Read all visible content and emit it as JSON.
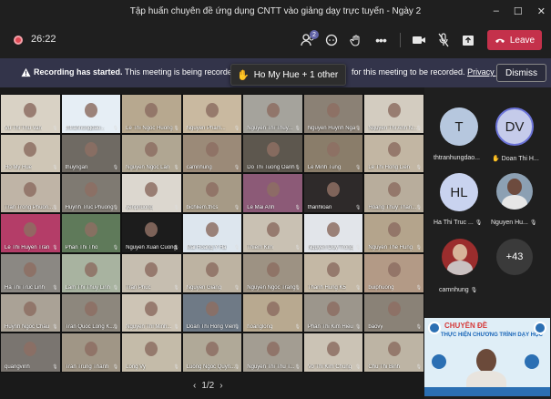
{
  "window": {
    "title": "Tập huấn chuyên đề ứng dụng CNTT vào giảng dạy trực tuyến - Ngày 2",
    "controls": [
      "–",
      "☐",
      "✕"
    ]
  },
  "toolbar": {
    "timer": "26:22",
    "participants_badge": "2",
    "leave_label": "Leave"
  },
  "banner": {
    "bold_text": "Recording has started.",
    "text_before": "This meeting is being recorded. By jo",
    "text_after": "for this meeting to be recorded.",
    "link": "Privacy policy",
    "dismiss_label": "Dismiss"
  },
  "tooltip": {
    "text": "Ho My Hue + 1 other"
  },
  "grid": {
    "tiles": [
      {
        "name": "Vu Thi Thu Van",
        "bg": "#d9d2c5"
      },
      {
        "name": "thtranhungdao...",
        "bg": "#e6eef5"
      },
      {
        "name": "Le Thi Ngoc Huong",
        "bg": "#b7a88f"
      },
      {
        "name": "Nguyen Pham...",
        "bg": "#c9b9a0"
      },
      {
        "name": "Nguyen Thi Thuy...",
        "bg": "#a5a39c"
      },
      {
        "name": "Nguyen Huynh Nga",
        "bg": "#8b8175"
      },
      {
        "name": "Nguyen Thi Anh N...",
        "bg": "#d3ccc0"
      },
      {
        "name": "Ho My Hue",
        "bg": "#cfc6b6"
      },
      {
        "name": "thuyngan",
        "bg": "#6f6a63"
      },
      {
        "name": "Nguyen Ngoc Lan",
        "bg": "#b0a692"
      },
      {
        "name": "camnhung",
        "bg": "#9b8a78"
      },
      {
        "name": "Do Thi Tuong Oanh",
        "bg": "#5d574e"
      },
      {
        "name": "Le Minh Tung",
        "bg": "#8a7d6a"
      },
      {
        "name": "Le Thi Hong Lien",
        "bg": "#c2b6a3"
      },
      {
        "name": "Tran Trong Phuon...",
        "bg": "#bfb4a6"
      },
      {
        "name": "Huynh Truc Phuong",
        "bg": "#7f7a72"
      },
      {
        "name": "yenphuong",
        "bg": "#dcd7cf"
      },
      {
        "name": "bichliem.thcs",
        "bg": "#a69a86"
      },
      {
        "name": "Le Mai Anh",
        "bg": "#8c5a77"
      },
      {
        "name": "thanhloan",
        "bg": "#2e2a2a"
      },
      {
        "name": "Hoang Thuy Than...",
        "bg": "#b8ad9c"
      },
      {
        "name": "Le Thi Huyen Tran",
        "bg": "#b43d68"
      },
      {
        "name": "Phan Thi Tho",
        "bg": "#5f7a5a"
      },
      {
        "name": "Nguyen Xuan Cuong",
        "bg": "#1c1c1c"
      },
      {
        "name": "Mai Hoang Y Ha",
        "bg": "#dde6ee"
      },
      {
        "name": "Thiem Kim",
        "bg": "#c9c1b3"
      },
      {
        "name": "Nguyen Duy Trong",
        "bg": "#e2e5ea"
      },
      {
        "name": "Nguyen The Hung",
        "bg": "#b4a48c"
      },
      {
        "name": "Ha Thi Truc Linh",
        "bg": "#8b8883"
      },
      {
        "name": "Lam Thi Thuy Linh",
        "bg": "#a8b3a0"
      },
      {
        "name": "Tran Phuc",
        "bg": "#c6beb0"
      },
      {
        "name": "Nguyen Giang",
        "bg": "#bdb3a2"
      },
      {
        "name": "Nguyen Ngoc Trang",
        "bg": "#9d9283"
      },
      {
        "name": "Thanh Hung K5",
        "bg": "#c4b8a5"
      },
      {
        "name": "buiphuong",
        "bg": "#b39a86"
      },
      {
        "name": "Huynh Ngoc Chau",
        "bg": "#aaa296"
      },
      {
        "name": "Tran Quoc Long K...",
        "bg": "#8d877d"
      },
      {
        "name": "Nguyen Thi Minh...",
        "bg": "#cdc4b5"
      },
      {
        "name": "Doan Thi Hong Vien",
        "bg": "#6f7a86"
      },
      {
        "name": "hoanglong",
        "bg": "#b8a990"
      },
      {
        "name": "Phan Thi Kim Hieu",
        "bg": "#9c968c"
      },
      {
        "name": "baovy",
        "bg": "#8a8277"
      },
      {
        "name": "quangvinh",
        "bg": "#7a7570"
      },
      {
        "name": "Tran Trung Thanh",
        "bg": "#a09686"
      },
      {
        "name": "Long Vy",
        "bg": "#c4bba9"
      },
      {
        "name": "Luong Ngoc Quyn...",
        "bg": "#b0a998"
      },
      {
        "name": "Nguyen Thi Thu T...",
        "bg": "#a39d92"
      },
      {
        "name": "Vo Thi Kim Chung",
        "bg": "#cbc3b5"
      },
      {
        "name": "Chu Thi Binh",
        "bg": "#bdb4a4"
      }
    ],
    "pager": {
      "prev": "‹",
      "label": "1/2",
      "next": "›"
    }
  },
  "side": {
    "participants": [
      {
        "initials": "T",
        "name": "thtranhungdao...",
        "color": "#b6c7de"
      },
      {
        "initials": "DV",
        "name": "Doan Thi H...",
        "color": "#c5cbea"
      },
      {
        "initials": "HL",
        "name": "Ha Thi Truc ...",
        "color": "#c9d3ef"
      },
      {
        "initials": "",
        "name": "Nguyen Hu...",
        "color": "#8ca0b3"
      },
      {
        "initials": "",
        "name": "camnhung",
        "color": "#9b2d2d"
      }
    ],
    "more_label": "+43"
  },
  "selfview": {
    "title": "CHUYÊN ĐỀ",
    "subtitle": "THỰC HIỆN CHƯƠNG TRÌNH DẠY HỌC"
  }
}
